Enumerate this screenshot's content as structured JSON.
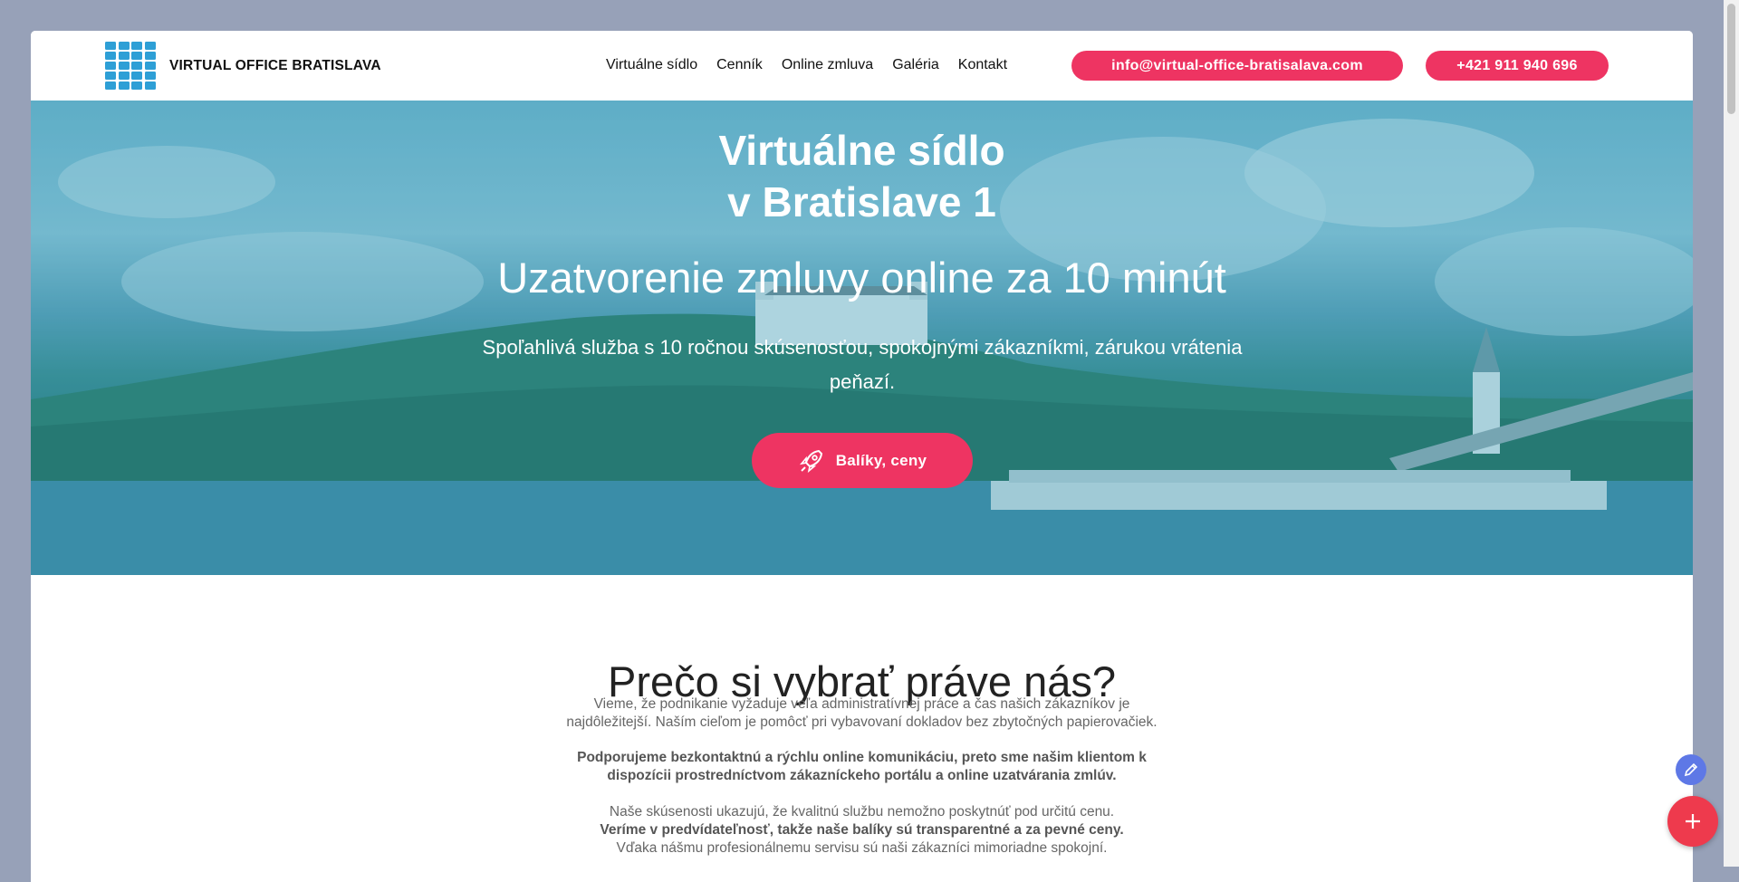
{
  "header": {
    "logo_text": "VIRTUAL OFFICE BRATISLAVA",
    "logo_icon": "grid-logo-icon",
    "nav": [
      {
        "label": "Virtuálne sídlo"
      },
      {
        "label": "Cenník"
      },
      {
        "label": "Online zmluva"
      },
      {
        "label": "Galéria"
      },
      {
        "label": "Kontakt"
      }
    ],
    "email": "info@virtual-office-bratisalava.com",
    "phone": "+421 911 940 696"
  },
  "hero": {
    "title_line1": "Virtuálne sídlo",
    "title_line2": "v Bratislave 1",
    "subtitle": "Uzatvorenie zmluvy online za 10 minút",
    "description": "Spoľahlivá služba s 10 ročnou skúsenosťou, spokojnými zákazníkmi, zárukou vrátenia peňazí.",
    "cta_label": "Balíky, ceny",
    "cta_icon": "rocket-icon"
  },
  "why": {
    "title": "Prečo si vybrať práve nás?",
    "p1_line1": "Vieme, že podnikanie vyžaduje veľa administratívnej práce a čas našich zákazníkov je",
    "p1_line2": "najdôležitejší. Naším cieľom je pomôcť pri vybavovaní dokladov bez zbytočných papierovačiek.",
    "p2_line1": "Podporujeme bezkontaktnú a rýchlu online komunikáciu, preto sme našim klientom k",
    "p2_line2": "dispozícii prostredníctvom zákazníckeho portálu a online uzatvárania zmlúv.",
    "p3_line1": "Naše skúsenosti ukazujú, že kvalitnú službu nemožno poskytnúť pod určitú cenu.",
    "p3_line2": "Veríme v predvídateľnosť, takže naše balíky sú transparentné a za pevné ceny.",
    "p3_line3": "Vďaka nášmu profesionálnemu servisu sú naši zákazníci mimoriadne spokojní."
  },
  "colors": {
    "accent": "#ee3462",
    "logo_blue": "#2e9fd6",
    "page_bg": "#97a1b8",
    "edit_fab": "#5e78e6"
  },
  "floating": {
    "edit_icon": "pencil-icon",
    "add_icon": "plus-icon"
  }
}
